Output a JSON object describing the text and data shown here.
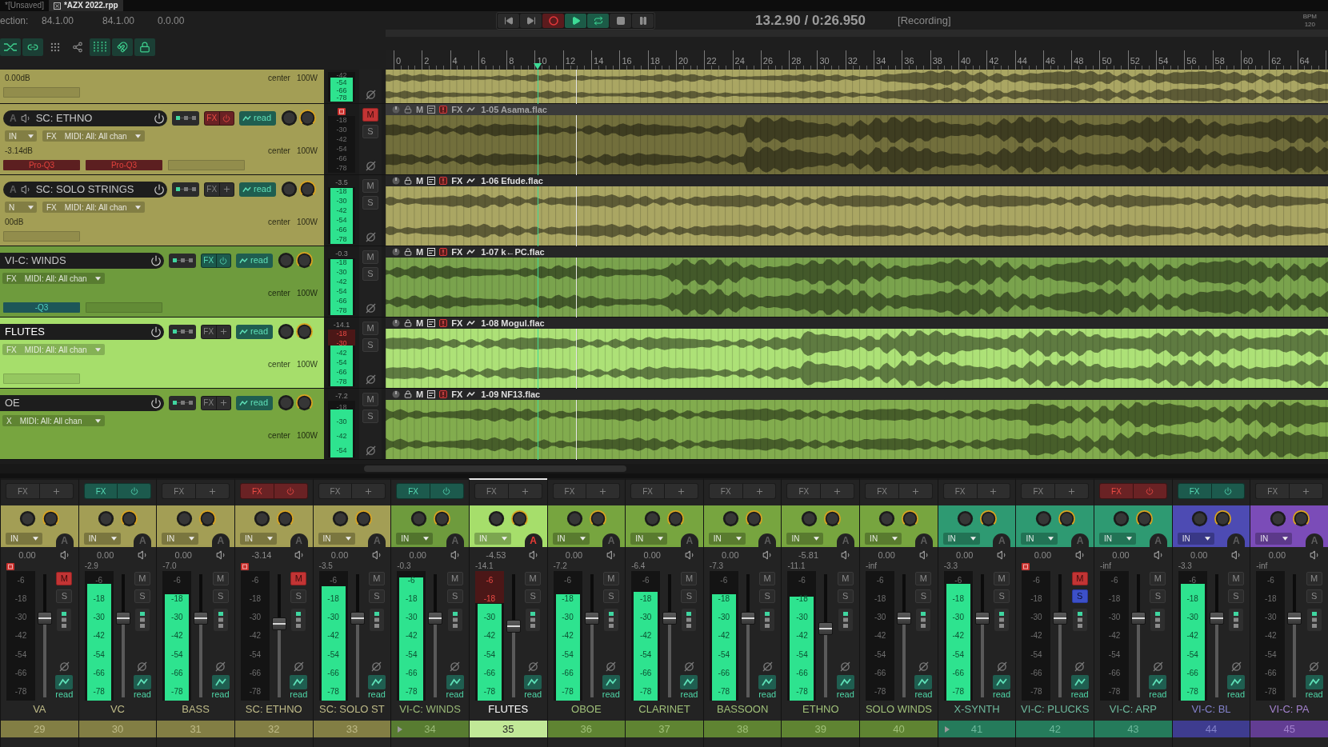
{
  "tabs": [
    {
      "label": "*[Unsaved]",
      "selected": false
    },
    {
      "label": "*AZX 2022.rpp",
      "selected": true
    }
  ],
  "selection": {
    "label": "ection:",
    "start": "84.1.00",
    "end": "84.1.00",
    "length": "0.0.00"
  },
  "transport": {
    "buttons": [
      {
        "kind": "prev",
        "on": false
      },
      {
        "kind": "next",
        "on": false
      },
      {
        "kind": "record",
        "on": true
      },
      {
        "kind": "play",
        "on": true
      },
      {
        "kind": "repeat",
        "on": true
      },
      {
        "kind": "stop",
        "on": false
      },
      {
        "kind": "pause",
        "on": false
      }
    ],
    "position": "13.2.90 / 0:26.950",
    "status": "[Recording]",
    "bpm_label": "BPM",
    "bpm": "120"
  },
  "toolbar": [
    {
      "kind": "crossfade",
      "on": true
    },
    {
      "kind": "link",
      "on": true
    },
    {
      "kind": "dots",
      "on": false
    },
    {
      "kind": "share",
      "on": false
    },
    {
      "kind": "grid",
      "on": true
    },
    {
      "kind": "magnet",
      "on": true
    },
    {
      "kind": "lock",
      "on": true
    }
  ],
  "ruler": {
    "labels": [
      "0",
      "2",
      "4",
      "6",
      "8",
      "10",
      "12",
      "14",
      "16",
      "18",
      "20",
      "22",
      "24",
      "26",
      "28",
      "30",
      "32",
      "34",
      "36",
      "38",
      "40",
      "42",
      "44",
      "46",
      "48",
      "50",
      "52",
      "54",
      "56",
      "58",
      "60",
      "62",
      "64"
    ]
  },
  "tracks": [
    {
      "color": "#a39e55",
      "gain": "0.00dB",
      "pan": "center",
      "width": "100W",
      "slots": [
        {
          "kind": "empty"
        }
      ],
      "meter": {
        "level": 0.8,
        "clipped": false,
        "scale": [
          "-42",
          "-54",
          "-66",
          "-78"
        ]
      }
    },
    {
      "arm_label": "A",
      "name": "SC: ETHNO",
      "color": "#a39e55",
      "selected": false,
      "fx": {
        "label": "FX",
        "kind": "offline"
      },
      "automation": "read",
      "input": "IN",
      "input_fx": "FX",
      "midi": "MIDI: All: All chan",
      "gain": "-3.14dB",
      "pan": "center",
      "width": "100W",
      "slots": [
        {
          "label": "Pro-Q3",
          "kind": "offline"
        },
        {
          "label": "Pro-Q3",
          "kind": "offline"
        },
        {
          "kind": "empty"
        }
      ],
      "meter": {
        "clipped": false,
        "scale": [
          "-18",
          "-30",
          "-42",
          "-54",
          "-66",
          "-78"
        ]
      },
      "mute": {
        "label": "M",
        "on": true
      },
      "solo": {
        "label": "S",
        "on": false
      },
      "item": {
        "name": "1-05 Asama.flac",
        "mute_label": "M",
        "fx_label": "FX"
      }
    },
    {
      "arm_label": "A",
      "name": "SC: SOLO STRINGS",
      "color": "#a39e55",
      "selected": false,
      "fx": {
        "label": "FX",
        "kind": "empty"
      },
      "automation": "read",
      "input": "N",
      "input_fx": "FX",
      "midi": "MIDI: All: All chan",
      "gain": "00dB",
      "pan": "center",
      "width": "100W",
      "slots": [
        {
          "kind": "empty"
        }
      ],
      "meter": {
        "peak": "-3.5",
        "level": 0.99,
        "clipped": false,
        "scale": [
          "-18",
          "-30",
          "-42",
          "-54",
          "-66",
          "-78"
        ]
      },
      "mute": {
        "label": "M",
        "on": false
      },
      "solo": {
        "label": "S",
        "on": false
      },
      "item": {
        "name": "1-06 Efude.flac",
        "mute_label": "M",
        "fx_label": "FX"
      }
    },
    {
      "name": "VI-C: WINDS",
      "color": "#6e9b3d",
      "selected": false,
      "fx": {
        "label": "FX",
        "kind": "active"
      },
      "automation": "read",
      "input_fx": "FX",
      "midi": "MIDI: All: All chan",
      "pan": "center",
      "width": "100W",
      "slots": [
        {
          "label": "-Q3",
          "kind": "active"
        },
        {
          "kind": "empty"
        }
      ],
      "meter": {
        "peak": "-0.3",
        "level": 0.99,
        "clipped": false,
        "scale": [
          "-18",
          "-30",
          "-42",
          "-54",
          "-66",
          "-78"
        ]
      },
      "mute": {
        "label": "M",
        "on": false
      },
      "solo": {
        "label": "S",
        "on": false
      },
      "item": {
        "name": "1-07 k←PC.flac",
        "mute_label": "M",
        "fx_label": "FX"
      }
    },
    {
      "name": "FLUTES",
      "color": "#a6de6b",
      "selected": true,
      "fx": {
        "label": "FX",
        "kind": "empty"
      },
      "automation": "read",
      "input_fx": "FX",
      "midi": "MIDI: All: All chan",
      "pan": "center",
      "width": "100W",
      "slots": [
        {
          "kind": "empty"
        }
      ],
      "meter": {
        "peak": "-14.1",
        "level": 0.72,
        "clipped": true,
        "scale": [
          "-18",
          "-30",
          "-42",
          "-54",
          "-66",
          "-78"
        ]
      },
      "mute": {
        "label": "M",
        "on": false
      },
      "solo": {
        "label": "S",
        "on": false
      },
      "item": {
        "name": "1-08 Mogul.flac",
        "mute_label": "M",
        "fx_label": "FX"
      }
    },
    {
      "name": "OE",
      "color": "#77a53f",
      "selected": false,
      "fx": {
        "label": "FX",
        "kind": "empty"
      },
      "automation": "read",
      "input_fx": "X",
      "midi": "MIDI: All: All chan",
      "pan": "center",
      "width": "100W",
      "meter": {
        "peak": "-7.2",
        "level": 0.85,
        "clipped": false,
        "scale": [
          "-18",
          "-30",
          "-42",
          "-54"
        ]
      },
      "mute": {
        "label": "M",
        "on": false
      },
      "solo": {
        "label": "S",
        "on": false
      },
      "item": {
        "name": "1-09 NF13.flac",
        "mute_label": "M",
        "fx_label": "FX"
      }
    }
  ],
  "mixer": {
    "strips": [
      {
        "name": "VA",
        "number": "29",
        "color": "#a39e55",
        "selected": false,
        "folder": false,
        "fx": {
          "label": "FX",
          "kind": "empty"
        },
        "input": "IN",
        "auto_arm": {
          "label": "A",
          "on": false
        },
        "volume": "0.00",
        "mute": {
          "label": "M",
          "on": true
        },
        "solo": {
          "label": "S",
          "on": false
        },
        "fader": {
          "level": 0.64
        },
        "meter": {
          "clipped": false,
          "scale": [
            "-6",
            "-18",
            "-30",
            "-42",
            "-54",
            "-66",
            "-78"
          ]
        },
        "automation": "read"
      },
      {
        "name": "VC",
        "number": "30",
        "color": "#a39e55",
        "selected": false,
        "folder": false,
        "fx": {
          "label": "FX",
          "kind": "active"
        },
        "input": "IN",
        "auto_arm": {
          "label": "A",
          "on": false
        },
        "volume": "0.00",
        "mute": {
          "label": "M",
          "on": false
        },
        "solo": {
          "label": "S",
          "on": false
        },
        "fader": {
          "level": 0.64
        },
        "meter": {
          "peak": "-2.9",
          "level": 0.9,
          "clipped": false,
          "scale": [
            "-6",
            "-18",
            "-30",
            "-42",
            "-54",
            "-66",
            "-78"
          ]
        },
        "automation": "read"
      },
      {
        "name": "BASS",
        "number": "31",
        "color": "#a39e55",
        "selected": false,
        "folder": false,
        "fx": {
          "label": "FX",
          "kind": "empty"
        },
        "input": "IN",
        "auto_arm": {
          "label": "A",
          "on": false
        },
        "volume": "0.00",
        "mute": {
          "label": "M",
          "on": false
        },
        "solo": {
          "label": "S",
          "on": false
        },
        "fader": {
          "level": 0.64
        },
        "meter": {
          "peak": "-7.0",
          "level": 0.82,
          "clipped": false,
          "scale": [
            "-6",
            "-18",
            "-30",
            "-42",
            "-54",
            "-66",
            "-78"
          ]
        },
        "automation": "read"
      },
      {
        "name": "SC: ETHNO",
        "number": "32",
        "color": "#a39e55",
        "selected": false,
        "folder": false,
        "fx": {
          "label": "FX",
          "kind": "offline"
        },
        "input": "IN",
        "auto_arm": {
          "label": "A",
          "on": false
        },
        "volume": "-3.14",
        "mute": {
          "label": "M",
          "on": true
        },
        "solo": {
          "label": "S",
          "on": false
        },
        "fader": {
          "level": 0.6
        },
        "meter": {
          "clipped": false,
          "scale": [
            "-6",
            "-18",
            "-30",
            "-42",
            "-54",
            "-66",
            "-78"
          ]
        },
        "automation": "read"
      },
      {
        "name": "SC: SOLO ST",
        "number": "33",
        "color": "#a39e55",
        "selected": false,
        "folder": false,
        "fx": {
          "label": "FX",
          "kind": "empty"
        },
        "input": "IN",
        "auto_arm": {
          "label": "A",
          "on": false
        },
        "volume": "0.00",
        "mute": {
          "label": "M",
          "on": false
        },
        "solo": {
          "label": "S",
          "on": false
        },
        "fader": {
          "level": 0.64
        },
        "meter": {
          "peak": "-3.5",
          "level": 0.88,
          "clipped": false,
          "scale": [
            "-6",
            "-18",
            "-30",
            "-42",
            "-54",
            "-66",
            "-78"
          ]
        },
        "automation": "read"
      },
      {
        "name": "VI-C: WINDS",
        "number": "34",
        "color": "#6e9b3d",
        "selected": false,
        "folder": true,
        "fx": {
          "label": "FX",
          "kind": "active"
        },
        "input": "IN",
        "auto_arm": {
          "label": "A",
          "on": false
        },
        "volume": "0.00",
        "mute": {
          "label": "M",
          "on": false
        },
        "solo": {
          "label": "S",
          "on": false
        },
        "fader": {
          "level": 0.64
        },
        "meter": {
          "peak": "-0.3",
          "level": 0.95,
          "clipped": false,
          "scale": [
            "-6",
            "-18",
            "-30",
            "-42",
            "-54",
            "-66",
            "-78"
          ]
        },
        "automation": "read"
      },
      {
        "name": "FLUTES",
        "number": "35",
        "color": "#a6de6b",
        "selected": true,
        "folder": false,
        "fx": {
          "label": "FX",
          "kind": "empty"
        },
        "input": "IN",
        "auto_arm": {
          "label": "A",
          "on": true
        },
        "volume": "-4.53",
        "mute": {
          "label": "M",
          "on": false
        },
        "solo": {
          "label": "S",
          "on": false
        },
        "fader": {
          "level": 0.58
        },
        "meter": {
          "peak": "-14.1",
          "level": 0.75,
          "clipped": true,
          "scale": [
            "-6",
            "-18",
            "-30",
            "-42",
            "-54",
            "-66",
            "-78"
          ]
        },
        "automation": "read"
      },
      {
        "name": "OBOE",
        "number": "36",
        "color": "#77a53f",
        "selected": false,
        "folder": false,
        "fx": {
          "label": "FX",
          "kind": "empty"
        },
        "input": "IN",
        "auto_arm": {
          "label": "A",
          "on": false
        },
        "volume": "0.00",
        "mute": {
          "label": "M",
          "on": false
        },
        "solo": {
          "label": "S",
          "on": false
        },
        "fader": {
          "level": 0.64
        },
        "meter": {
          "peak": "-7.2",
          "level": 0.82,
          "clipped": false,
          "scale": [
            "-6",
            "-18",
            "-30",
            "-42",
            "-54",
            "-66",
            "-78"
          ]
        },
        "automation": "read"
      },
      {
        "name": "CLARINET",
        "number": "37",
        "color": "#77a53f",
        "selected": false,
        "folder": false,
        "fx": {
          "label": "FX",
          "kind": "empty"
        },
        "input": "IN",
        "auto_arm": {
          "label": "A",
          "on": false
        },
        "volume": "0.00",
        "mute": {
          "label": "M",
          "on": false
        },
        "solo": {
          "label": "S",
          "on": false
        },
        "fader": {
          "level": 0.64
        },
        "meter": {
          "peak": "-6.4",
          "level": 0.84,
          "clipped": false,
          "scale": [
            "-6",
            "-18",
            "-30",
            "-42",
            "-54",
            "-66",
            "-78"
          ]
        },
        "automation": "read"
      },
      {
        "name": "BASSOON",
        "number": "38",
        "color": "#77a53f",
        "selected": false,
        "folder": false,
        "fx": {
          "label": "FX",
          "kind": "empty"
        },
        "input": "IN",
        "auto_arm": {
          "label": "A",
          "on": false
        },
        "volume": "0.00",
        "mute": {
          "label": "M",
          "on": false
        },
        "solo": {
          "label": "S",
          "on": false
        },
        "fader": {
          "level": 0.64
        },
        "meter": {
          "peak": "-7.3",
          "level": 0.82,
          "clipped": false,
          "scale": [
            "-6",
            "-18",
            "-30",
            "-42",
            "-54",
            "-66",
            "-78"
          ]
        },
        "automation": "read"
      },
      {
        "name": "ETHNO",
        "number": "39",
        "color": "#77a53f",
        "selected": false,
        "folder": false,
        "fx": {
          "label": "FX",
          "kind": "empty"
        },
        "input": "IN",
        "auto_arm": {
          "label": "A",
          "on": false
        },
        "volume": "-5.81",
        "mute": {
          "label": "M",
          "on": false
        },
        "solo": {
          "label": "S",
          "on": false
        },
        "fader": {
          "level": 0.56
        },
        "meter": {
          "peak": "-11.1",
          "level": 0.8,
          "clipped": false,
          "scale": [
            "-6",
            "-18",
            "-30",
            "-42",
            "-54",
            "-66",
            "-78"
          ]
        },
        "automation": "read"
      },
      {
        "name": "SOLO WINDS",
        "number": "40",
        "color": "#77a53f",
        "selected": false,
        "folder": false,
        "fx": {
          "label": "FX",
          "kind": "empty"
        },
        "input": "IN",
        "auto_arm": {
          "label": "A",
          "on": false
        },
        "volume": "0.00",
        "mute": {
          "label": "M",
          "on": false
        },
        "solo": {
          "label": "S",
          "on": false
        },
        "fader": {
          "level": 0.64
        },
        "meter": {
          "peak": "-inf",
          "clipped": false,
          "scale": [
            "-6",
            "-18",
            "-30",
            "-42",
            "-54",
            "-66",
            "-78"
          ]
        },
        "automation": "read"
      },
      {
        "name": "X-SYNTH",
        "number": "41",
        "color": "#2e9a72",
        "selected": false,
        "folder": true,
        "fx": {
          "label": "FX",
          "kind": "empty"
        },
        "input": "IN",
        "auto_arm": {
          "label": "A",
          "on": false
        },
        "volume": "0.00",
        "mute": {
          "label": "M",
          "on": false
        },
        "solo": {
          "label": "S",
          "on": false
        },
        "fader": {
          "level": 0.64
        },
        "meter": {
          "peak": "-3.3",
          "level": 0.9,
          "clipped": false,
          "scale": [
            "-6",
            "-18",
            "-30",
            "-42",
            "-54",
            "-66",
            "-78"
          ]
        },
        "automation": "read"
      },
      {
        "name": "VI-C: PLUCKS",
        "number": "42",
        "color": "#2e9a72",
        "selected": false,
        "folder": false,
        "fx": {
          "label": "FX",
          "kind": "empty"
        },
        "input": "IN",
        "auto_arm": {
          "label": "A",
          "on": false
        },
        "volume": "0.00",
        "mute": {
          "label": "M",
          "on": true
        },
        "solo": {
          "label": "S",
          "on": true
        },
        "fader": {
          "level": 0.64
        },
        "meter": {
          "clipped": false,
          "scale": [
            "-6",
            "-18",
            "-30",
            "-42",
            "-54",
            "-66",
            "-78"
          ]
        },
        "automation": "read"
      },
      {
        "name": "VI-C: ARP",
        "number": "43",
        "color": "#2e9a72",
        "selected": false,
        "folder": false,
        "fx": {
          "label": "FX",
          "kind": "offline"
        },
        "input": "IN",
        "auto_arm": {
          "label": "A",
          "on": false
        },
        "volume": "0.00",
        "mute": {
          "label": "M",
          "on": false
        },
        "solo": {
          "label": "S",
          "on": false
        },
        "fader": {
          "level": 0.64
        },
        "meter": {
          "peak": "-inf",
          "clipped": false,
          "scale": [
            "-6",
            "-18",
            "-30",
            "-42",
            "-54",
            "-66",
            "-78"
          ]
        },
        "automation": "read"
      },
      {
        "name": "VI-C: BL",
        "number": "44",
        "color": "#4d4bb3",
        "selected": false,
        "folder": false,
        "fx": {
          "label": "FX",
          "kind": "active"
        },
        "input": "IN",
        "auto_arm": {
          "label": "A",
          "on": false
        },
        "volume": "0.00",
        "mute": {
          "label": "M",
          "on": false
        },
        "solo": {
          "label": "S",
          "on": false
        },
        "fader": {
          "level": 0.64
        },
        "meter": {
          "peak": "-3.3",
          "level": 0.9,
          "clipped": false,
          "scale": [
            "-6",
            "-18",
            "-30",
            "-42",
            "-54",
            "-66",
            "-78"
          ]
        },
        "automation": "read"
      },
      {
        "name": "VI-C: PA",
        "number": "45",
        "color": "#7b4cb8",
        "selected": false,
        "folder": false,
        "fx": {
          "label": "FX",
          "kind": "empty"
        },
        "input": "IN",
        "auto_arm": {
          "label": "A",
          "on": false
        },
        "volume": "0.00",
        "mute": {
          "label": "M",
          "on": false
        },
        "solo": {
          "label": "S",
          "on": false
        },
        "fader": {
          "level": 0.64
        },
        "meter": {
          "peak": "-inf",
          "clipped": false,
          "scale": [
            "-6",
            "-18",
            "-30",
            "-42",
            "-54",
            "-66",
            "-78"
          ]
        },
        "automation": "read"
      }
    ]
  }
}
